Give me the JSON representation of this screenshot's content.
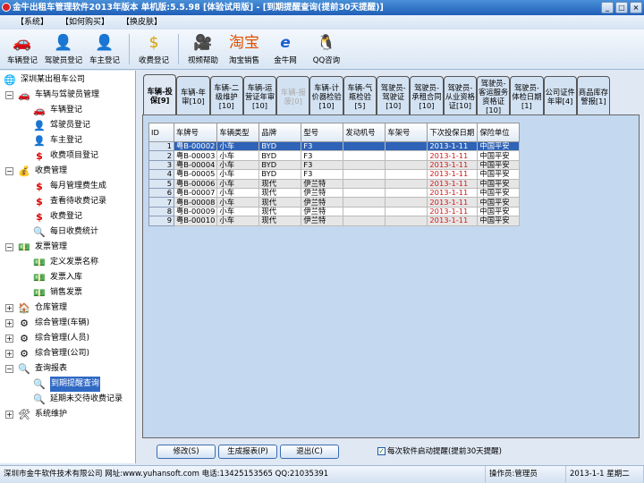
{
  "window": {
    "title": "金牛出租车管理软件2013年版本 单机版:5.5.98 [体验试用版] - [到期提醒查询(提前30天提醒)]",
    "buttons": [
      "_",
      "□",
      "×"
    ]
  },
  "menu": [
    "【系统】",
    "【如何购买】",
    "【换皮肤】"
  ],
  "toolbar": [
    {
      "label": "车辆登记",
      "icon": "car-icon",
      "glyph": "🚗"
    },
    {
      "label": "驾驶员登记",
      "icon": "driver-icon",
      "glyph": "👤"
    },
    {
      "label": "车主登记",
      "icon": "owner-icon",
      "glyph": "👤"
    },
    {
      "label": "收费登记",
      "icon": "dollar-icon",
      "glyph": "$"
    },
    {
      "label": "视频帮助",
      "icon": "video-camera-icon",
      "glyph": "🎥"
    },
    {
      "label": "淘宝销售",
      "icon": "taobao-icon",
      "glyph": "淘宝"
    },
    {
      "label": "金牛网",
      "icon": "ie-browser-icon",
      "glyph": "e"
    },
    {
      "label": "QQ咨询",
      "icon": "qq-penguin-icon",
      "glyph": "🐧"
    }
  ],
  "tree": [
    {
      "label": "深圳某出租车公司",
      "level": 0,
      "glyph": "🌐"
    },
    {
      "label": "车辆与驾驶员管理",
      "level": 1,
      "exp": "−",
      "glyph": "🚗"
    },
    {
      "label": "车辆登记",
      "level": 2,
      "glyph": "🚗"
    },
    {
      "label": "驾驶员登记",
      "level": 2,
      "glyph": "👤"
    },
    {
      "label": "车主登记",
      "level": 2,
      "glyph": "👤"
    },
    {
      "label": "收费项目登记",
      "level": 2,
      "glyph": "$"
    },
    {
      "label": "收费管理",
      "level": 1,
      "exp": "−",
      "glyph": "💰"
    },
    {
      "label": "每月管理费生成",
      "level": 2,
      "glyph": "$"
    },
    {
      "label": "查看待收费记录",
      "level": 2,
      "glyph": "$"
    },
    {
      "label": "收费登记",
      "level": 2,
      "glyph": "$"
    },
    {
      "label": "每日收费统计",
      "level": 2,
      "glyph": "🔍"
    },
    {
      "label": "发票管理",
      "level": 1,
      "exp": "−",
      "glyph": "💵"
    },
    {
      "label": "定义发票名称",
      "level": 2,
      "glyph": "💵"
    },
    {
      "label": "发票入库",
      "level": 2,
      "glyph": "💵"
    },
    {
      "label": "销售发票",
      "level": 2,
      "glyph": "💵"
    },
    {
      "label": "仓库管理",
      "level": 1,
      "exp": "+",
      "glyph": "🏠"
    },
    {
      "label": "综合管理(车辆)",
      "level": 1,
      "exp": "+",
      "glyph": "⚙"
    },
    {
      "label": "综合管理(人员)",
      "level": 1,
      "exp": "+",
      "glyph": "⚙"
    },
    {
      "label": "综合管理(公司)",
      "level": 1,
      "exp": "+",
      "glyph": "⚙"
    },
    {
      "label": "查询报表",
      "level": 1,
      "exp": "−",
      "glyph": "🔍"
    },
    {
      "label": "到期提醒查询",
      "level": 2,
      "glyph": "🔍",
      "selected": true
    },
    {
      "label": "延期未交待收费记录",
      "level": 2,
      "glyph": "🔍"
    },
    {
      "label": "系统维护",
      "level": 1,
      "exp": "+",
      "glyph": "🛠"
    }
  ],
  "tabs": [
    {
      "label": "车辆-投保[9]",
      "active": true
    },
    {
      "label": "车辆-年审[10]"
    },
    {
      "label": "车辆-二级维护[10]"
    },
    {
      "label": "车辆-运营证年审[10]"
    },
    {
      "label": "车辆-报废[0]",
      "disabled": true
    },
    {
      "label": "车辆-计价器检验[10]"
    },
    {
      "label": "车辆-气瓶检验[5]"
    },
    {
      "label": "驾驶员-驾驶证[10]"
    },
    {
      "label": "驾驶员-承租合同[10]"
    },
    {
      "label": "驾驶员-从业资格证[10]"
    },
    {
      "label": "驾驶员-客运服务资格证[10]"
    },
    {
      "label": "驾驶员-体检日期[1]"
    },
    {
      "label": "公司证件年审[4]"
    },
    {
      "label": "商品库存警报[1]"
    }
  ],
  "grid": {
    "columns": [
      "ID",
      "车牌号",
      "车辆类型",
      "品牌",
      "型号",
      "发动机号",
      "车架号",
      "下次投保日期",
      "保险单位"
    ],
    "rows": [
      [
        "1",
        "粤B-00002",
        "小车",
        "BYD",
        "F3",
        "",
        "",
        "2013-1-11",
        "中国平安"
      ],
      [
        "2",
        "粤B-00003",
        "小车",
        "BYD",
        "F3",
        "",
        "",
        "2013-1-11",
        "中国平安"
      ],
      [
        "3",
        "粤B-00004",
        "小车",
        "BYD",
        "F3",
        "",
        "",
        "2013-1-11",
        "中国平安"
      ],
      [
        "4",
        "粤B-00005",
        "小车",
        "BYD",
        "F3",
        "",
        "",
        "2013-1-11",
        "中国平安"
      ],
      [
        "5",
        "粤B-00006",
        "小车",
        "现代",
        "伊兰特",
        "",
        "",
        "2013-1-11",
        "中国平安"
      ],
      [
        "6",
        "粤B-00007",
        "小车",
        "现代",
        "伊兰特",
        "",
        "",
        "2013-1-11",
        "中国平安"
      ],
      [
        "7",
        "粤B-00008",
        "小车",
        "现代",
        "伊兰特",
        "",
        "",
        "2013-1-11",
        "中国平安"
      ],
      [
        "8",
        "粤B-00009",
        "小车",
        "现代",
        "伊兰特",
        "",
        "",
        "2013-1-11",
        "中国平安"
      ],
      [
        "9",
        "粤B-00010",
        "小车",
        "现代",
        "伊兰特",
        "",
        "",
        "2013-1-11",
        "中国平安"
      ]
    ],
    "selected_row": 0
  },
  "buttons": {
    "edit": "修改(S)",
    "report": "生成报表(P)",
    "exit": "退出(C)"
  },
  "checkbox": {
    "label": "每次软件启动提醒(提前30天提醒)",
    "checked": true
  },
  "status": {
    "company": "深圳市金牛软件技术有限公司 网址:www.yuhansoft.com 电话:13425153565 QQ:21035391",
    "operator": "操作员:管理员",
    "date": "2013-1-1 星期二"
  }
}
